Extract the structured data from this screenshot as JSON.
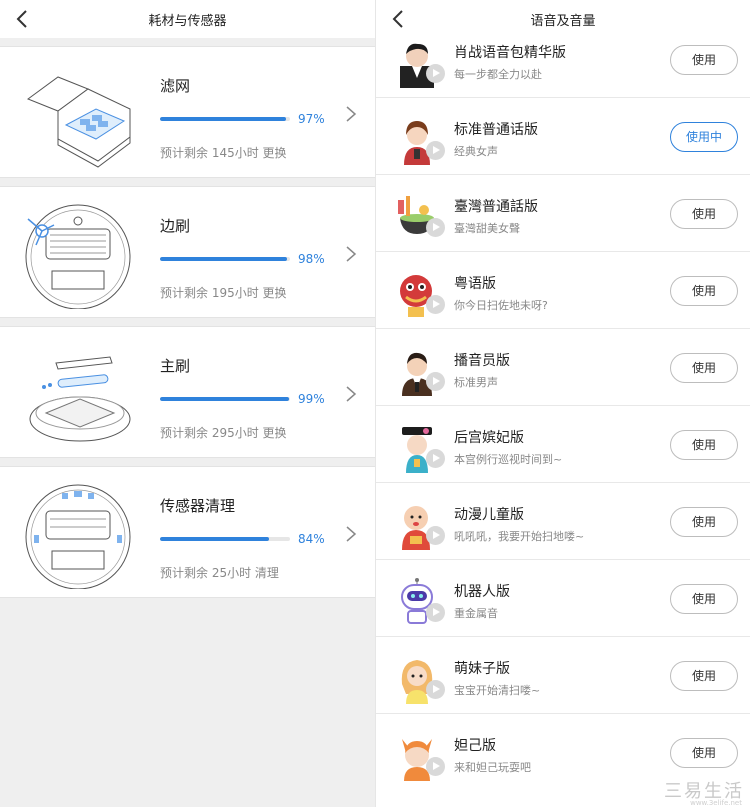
{
  "left": {
    "title": "耗材与传感器",
    "items": [
      {
        "name": "滤网",
        "percent": "97%",
        "level": 0.97,
        "note": "预计剩余 145小时 更换"
      },
      {
        "name": "边刷",
        "percent": "98%",
        "level": 0.98,
        "note": "预计剩余 195小时 更换"
      },
      {
        "name": "主刷",
        "percent": "99%",
        "level": 0.99,
        "note": "预计剩余 295小时 更换"
      },
      {
        "name": "传感器清理",
        "percent": "84%",
        "level": 0.84,
        "note": "预计剩余 25小时 清理"
      }
    ]
  },
  "right": {
    "title": "语音及音量",
    "voices": [
      {
        "name": "肖战语音包精华版",
        "desc": "每一步都全力以赴",
        "button": "使用",
        "active": false
      },
      {
        "name": "标准普通话版",
        "desc": "经典女声",
        "button": "使用中",
        "active": true
      },
      {
        "name": "臺灣普通話版",
        "desc": "臺灣甜美女聲",
        "button": "使用",
        "active": false
      },
      {
        "name": "粤语版",
        "desc": "你今日扫佐地未呀?",
        "button": "使用",
        "active": false
      },
      {
        "name": "播音员版",
        "desc": "标准男声",
        "button": "使用",
        "active": false
      },
      {
        "name": "后宫嫔妃版",
        "desc": "本宫例行巡视时间到~",
        "button": "使用",
        "active": false
      },
      {
        "name": "动漫儿童版",
        "desc": "吼吼吼，我要开始扫地喽~",
        "button": "使用",
        "active": false
      },
      {
        "name": "机器人版",
        "desc": "重金属音",
        "button": "使用",
        "active": false
      },
      {
        "name": "萌妹子版",
        "desc": "宝宝开始清扫喽~",
        "button": "使用",
        "active": false
      },
      {
        "name": "妲己版",
        "desc": "来和妲己玩耍吧",
        "button": "使用",
        "active": false
      }
    ]
  },
  "watermark": {
    "main": "三易生活",
    "sub": "www.3elife.net"
  },
  "colors": {
    "accent": "#2f82dc",
    "progress_track": "#e6e6e6"
  }
}
